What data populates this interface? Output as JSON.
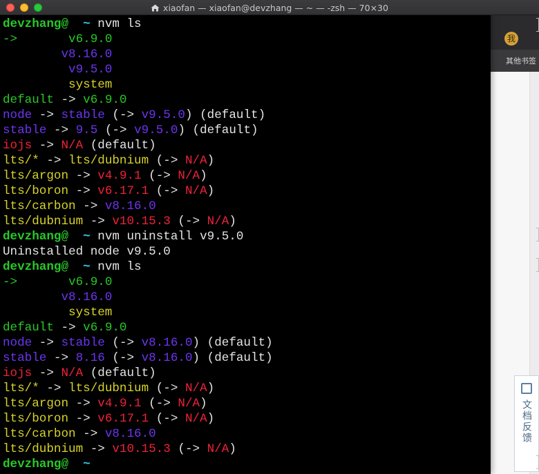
{
  "window": {
    "title": "xiaofan — xiaofan@devzhang — ~ — -zsh — 70×30"
  },
  "background": {
    "avatar_letter": "我",
    "bookmarks_label": "其他书签",
    "feedback_label": "文档反馈"
  },
  "terminal": {
    "lines": [
      [
        {
          "t": "devzhang@",
          "c": "seg-green seg-bold"
        },
        {
          "t": "  ~ ",
          "c": "seg-cyan seg-bold"
        },
        {
          "t": "nvm ls",
          "c": "seg-white"
        }
      ],
      [
        {
          "t": "->",
          "c": "seg-green"
        },
        {
          "t": "       v6.9.0",
          "c": "seg-green"
        }
      ],
      [
        {
          "t": "        v8.16.0",
          "c": "seg-purple"
        }
      ],
      [
        {
          "t": "         v9.5.0",
          "c": "seg-purple"
        }
      ],
      [
        {
          "t": "         system",
          "c": "seg-yellow"
        }
      ],
      [
        {
          "t": "default",
          "c": "seg-green"
        },
        {
          "t": " -> ",
          "c": "seg-white"
        },
        {
          "t": "v6.9.0",
          "c": "seg-green"
        }
      ],
      [
        {
          "t": "node",
          "c": "seg-purple"
        },
        {
          "t": " -> ",
          "c": "seg-white"
        },
        {
          "t": "stable",
          "c": "seg-purple"
        },
        {
          "t": " (-> ",
          "c": "seg-white"
        },
        {
          "t": "v9.5.0",
          "c": "seg-purple"
        },
        {
          "t": ") (default)",
          "c": "seg-white"
        }
      ],
      [
        {
          "t": "stable",
          "c": "seg-purple"
        },
        {
          "t": " -> ",
          "c": "seg-white"
        },
        {
          "t": "9.5",
          "c": "seg-purple"
        },
        {
          "t": " (-> ",
          "c": "seg-white"
        },
        {
          "t": "v9.5.0",
          "c": "seg-purple"
        },
        {
          "t": ") (default)",
          "c": "seg-white"
        }
      ],
      [
        {
          "t": "iojs",
          "c": "seg-red"
        },
        {
          "t": " -> ",
          "c": "seg-white"
        },
        {
          "t": "N/A",
          "c": "seg-red"
        },
        {
          "t": " (default)",
          "c": "seg-white"
        }
      ],
      [
        {
          "t": "lts/*",
          "c": "seg-yellow"
        },
        {
          "t": " -> ",
          "c": "seg-white"
        },
        {
          "t": "lts/dubnium",
          "c": "seg-yellow"
        },
        {
          "t": " (-> ",
          "c": "seg-white"
        },
        {
          "t": "N/A",
          "c": "seg-red"
        },
        {
          "t": ")",
          "c": "seg-white"
        }
      ],
      [
        {
          "t": "lts/argon",
          "c": "seg-yellow"
        },
        {
          "t": " -> ",
          "c": "seg-white"
        },
        {
          "t": "v4.9.1",
          "c": "seg-red"
        },
        {
          "t": " (-> ",
          "c": "seg-white"
        },
        {
          "t": "N/A",
          "c": "seg-red"
        },
        {
          "t": ")",
          "c": "seg-white"
        }
      ],
      [
        {
          "t": "lts/boron",
          "c": "seg-yellow"
        },
        {
          "t": " -> ",
          "c": "seg-white"
        },
        {
          "t": "v6.17.1",
          "c": "seg-red"
        },
        {
          "t": " (-> ",
          "c": "seg-white"
        },
        {
          "t": "N/A",
          "c": "seg-red"
        },
        {
          "t": ")",
          "c": "seg-white"
        }
      ],
      [
        {
          "t": "lts/carbon",
          "c": "seg-yellow"
        },
        {
          "t": " -> ",
          "c": "seg-white"
        },
        {
          "t": "v8.16.0",
          "c": "seg-purple"
        }
      ],
      [
        {
          "t": "lts/dubnium",
          "c": "seg-yellow"
        },
        {
          "t": " -> ",
          "c": "seg-white"
        },
        {
          "t": "v10.15.3",
          "c": "seg-red"
        },
        {
          "t": " (-> ",
          "c": "seg-white"
        },
        {
          "t": "N/A",
          "c": "seg-red"
        },
        {
          "t": ")",
          "c": "seg-white"
        }
      ],
      [
        {
          "t": "devzhang@",
          "c": "seg-green seg-bold"
        },
        {
          "t": "  ~ ",
          "c": "seg-cyan seg-bold"
        },
        {
          "t": "nvm uninstall v9.5.0",
          "c": "seg-white"
        }
      ],
      [
        {
          "t": "Uninstalled node v9.5.0",
          "c": "seg-white"
        }
      ],
      [
        {
          "t": "devzhang@",
          "c": "seg-green seg-bold"
        },
        {
          "t": "  ~ ",
          "c": "seg-cyan seg-bold"
        },
        {
          "t": "nvm ls",
          "c": "seg-white"
        }
      ],
      [
        {
          "t": "->",
          "c": "seg-green"
        },
        {
          "t": "       v6.9.0",
          "c": "seg-green"
        }
      ],
      [
        {
          "t": "        v8.16.0",
          "c": "seg-purple"
        }
      ],
      [
        {
          "t": "         system",
          "c": "seg-yellow"
        }
      ],
      [
        {
          "t": "default",
          "c": "seg-green"
        },
        {
          "t": " -> ",
          "c": "seg-white"
        },
        {
          "t": "v6.9.0",
          "c": "seg-green"
        }
      ],
      [
        {
          "t": "node",
          "c": "seg-purple"
        },
        {
          "t": " -> ",
          "c": "seg-white"
        },
        {
          "t": "stable",
          "c": "seg-purple"
        },
        {
          "t": " (-> ",
          "c": "seg-white"
        },
        {
          "t": "v8.16.0",
          "c": "seg-purple"
        },
        {
          "t": ") (default)",
          "c": "seg-white"
        }
      ],
      [
        {
          "t": "stable",
          "c": "seg-purple"
        },
        {
          "t": " -> ",
          "c": "seg-white"
        },
        {
          "t": "8.16",
          "c": "seg-purple"
        },
        {
          "t": " (-> ",
          "c": "seg-white"
        },
        {
          "t": "v8.16.0",
          "c": "seg-purple"
        },
        {
          "t": ") (default)",
          "c": "seg-white"
        }
      ],
      [
        {
          "t": "iojs",
          "c": "seg-red"
        },
        {
          "t": " -> ",
          "c": "seg-white"
        },
        {
          "t": "N/A",
          "c": "seg-red"
        },
        {
          "t": " (default)",
          "c": "seg-white"
        }
      ],
      [
        {
          "t": "lts/*",
          "c": "seg-yellow"
        },
        {
          "t": " -> ",
          "c": "seg-white"
        },
        {
          "t": "lts/dubnium",
          "c": "seg-yellow"
        },
        {
          "t": " (-> ",
          "c": "seg-white"
        },
        {
          "t": "N/A",
          "c": "seg-red"
        },
        {
          "t": ")",
          "c": "seg-white"
        }
      ],
      [
        {
          "t": "lts/argon",
          "c": "seg-yellow"
        },
        {
          "t": " -> ",
          "c": "seg-white"
        },
        {
          "t": "v4.9.1",
          "c": "seg-red"
        },
        {
          "t": " (-> ",
          "c": "seg-white"
        },
        {
          "t": "N/A",
          "c": "seg-red"
        },
        {
          "t": ")",
          "c": "seg-white"
        }
      ],
      [
        {
          "t": "lts/boron",
          "c": "seg-yellow"
        },
        {
          "t": " -> ",
          "c": "seg-white"
        },
        {
          "t": "v6.17.1",
          "c": "seg-red"
        },
        {
          "t": " (-> ",
          "c": "seg-white"
        },
        {
          "t": "N/A",
          "c": "seg-red"
        },
        {
          "t": ")",
          "c": "seg-white"
        }
      ],
      [
        {
          "t": "lts/carbon",
          "c": "seg-yellow"
        },
        {
          "t": " -> ",
          "c": "seg-white"
        },
        {
          "t": "v8.16.0",
          "c": "seg-purple"
        }
      ],
      [
        {
          "t": "lts/dubnium",
          "c": "seg-yellow"
        },
        {
          "t": " -> ",
          "c": "seg-white"
        },
        {
          "t": "v10.15.3",
          "c": "seg-red"
        },
        {
          "t": " (-> ",
          "c": "seg-white"
        },
        {
          "t": "N/A",
          "c": "seg-red"
        },
        {
          "t": ")",
          "c": "seg-white"
        }
      ],
      [
        {
          "t": "devzhang@",
          "c": "seg-green seg-bold"
        },
        {
          "t": "  ~ ",
          "c": "seg-cyan seg-bold"
        }
      ]
    ]
  }
}
